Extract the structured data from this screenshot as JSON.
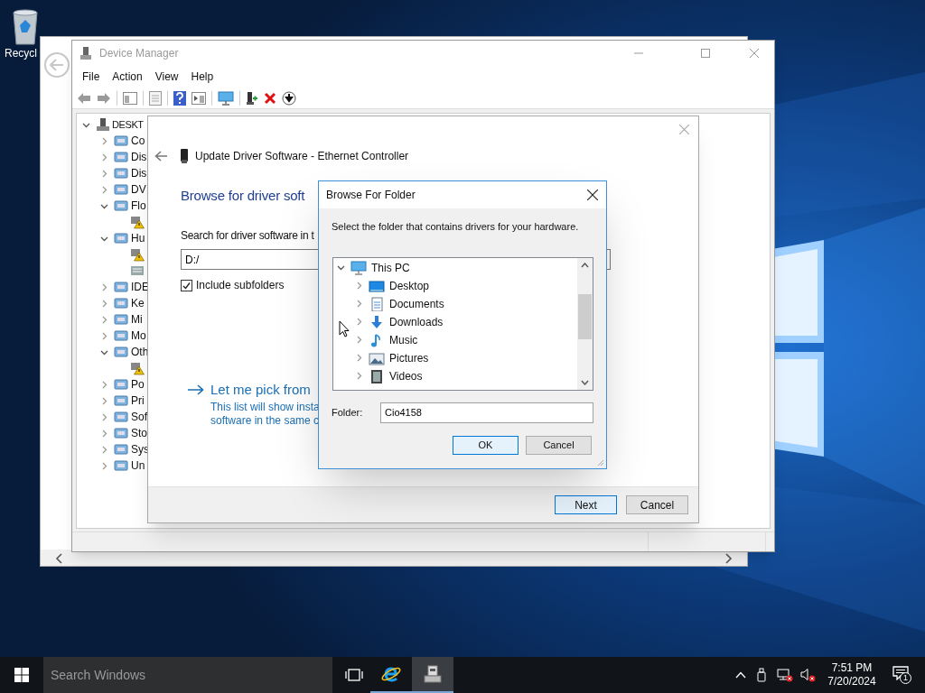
{
  "desktop": {
    "icons": [
      {
        "label": "Recycl"
      }
    ]
  },
  "device_manager": {
    "title": "Device Manager",
    "menu": [
      "File",
      "Action",
      "View",
      "Help"
    ],
    "tree": {
      "label": "DESKT",
      "expanded": true,
      "children": [
        {
          "label": "Co",
          "expanded": false
        },
        {
          "label": "Dis",
          "expanded": false
        },
        {
          "label": "Dis",
          "expanded": false
        },
        {
          "label": "DV",
          "expanded": false
        },
        {
          "label": "Flo",
          "expanded": true,
          "children": [
            {
              "warning": true
            }
          ]
        },
        {
          "label": "Hu",
          "expanded": true,
          "children": [
            {
              "warning": true
            },
            {
              "warning": false
            }
          ]
        },
        {
          "label": "IDE",
          "expanded": false
        },
        {
          "label": "Ke",
          "expanded": false
        },
        {
          "label": "Mi",
          "expanded": false
        },
        {
          "label": "Mo",
          "expanded": false
        },
        {
          "label": "Oth",
          "expanded": true,
          "children": [
            {
              "warning": true
            }
          ]
        },
        {
          "label": "Po",
          "expanded": false
        },
        {
          "label": "Pri",
          "expanded": false
        },
        {
          "label": "Sof",
          "expanded": false
        },
        {
          "label": "Sto",
          "expanded": false
        },
        {
          "label": "Sys",
          "expanded": false
        },
        {
          "label": "Un",
          "expanded": false
        }
      ]
    }
  },
  "update_driver": {
    "title": "Update Driver Software - Ethernet Controller",
    "heading": "Browse for driver soft",
    "search_label": "Search for driver software in t",
    "path": "D:/",
    "include_subfolders": {
      "label": "Include subfolders",
      "checked": true
    },
    "pick_link": "Let me pick from",
    "pick_description": [
      "This list will show insta",
      "software in the same c"
    ],
    "buttons": [
      {
        "label": "Next",
        "default": true
      },
      {
        "label": "Cancel",
        "default": false
      }
    ]
  },
  "browse_dialog": {
    "title": "Browse For Folder",
    "prompt": "Select the folder that contains drivers for your hardware.",
    "tree": {
      "label": "This PC",
      "expanded": true,
      "children": [
        {
          "label": "Desktop",
          "kind": "desktop",
          "expanded": false
        },
        {
          "label": "Documents",
          "kind": "documents",
          "expanded": false
        },
        {
          "label": "Downloads",
          "kind": "downloads",
          "expanded": false
        },
        {
          "label": "Music",
          "kind": "music",
          "expanded": false
        },
        {
          "label": "Pictures",
          "kind": "pictures",
          "expanded": false
        },
        {
          "label": "Videos",
          "kind": "videos",
          "expanded": false
        }
      ]
    },
    "folder_label": "Folder:",
    "folder_value": "Cio4158",
    "buttons": [
      {
        "label": "OK",
        "default": true
      },
      {
        "label": "Cancel",
        "default": false
      }
    ]
  },
  "taskbar": {
    "search_placeholder": "Search Windows",
    "apps": [
      {
        "kind": "browser",
        "selected": false
      },
      {
        "kind": "device-manager",
        "selected": true
      }
    ],
    "time": "7:51 PM",
    "date": "7/20/2024",
    "notifications": "1"
  }
}
